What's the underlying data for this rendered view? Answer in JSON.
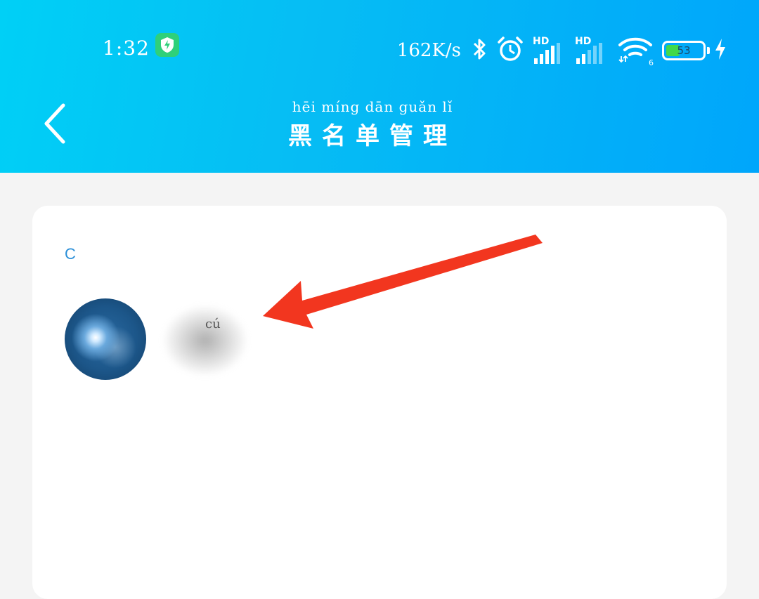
{
  "status_bar": {
    "time": "1:32",
    "net_speed": "162K/s",
    "wifi_sub": "6",
    "battery_percent": "53",
    "battery_level": 0.53,
    "icons": [
      "shield-bolt-icon",
      "bluetooth-icon",
      "alarm-icon",
      "signal-hd-icon",
      "signal-hd-icon",
      "wifi-icon",
      "battery-icon",
      "charging-icon"
    ],
    "hd_label": "HD"
  },
  "header": {
    "title_pinyin": "hēi míng dān guǎn  lǐ",
    "title": "黑名单管理",
    "back_icon": "chevron-left-icon"
  },
  "list": {
    "section_letter": "C",
    "contacts": [
      {
        "name": "cú"
      }
    ]
  },
  "colors": {
    "header_start": "#00d0f6",
    "header_end": "#00a6fb",
    "section_letter": "#2b8fd8",
    "annotation_arrow": "#f2361f",
    "background": "#f4f4f4"
  }
}
